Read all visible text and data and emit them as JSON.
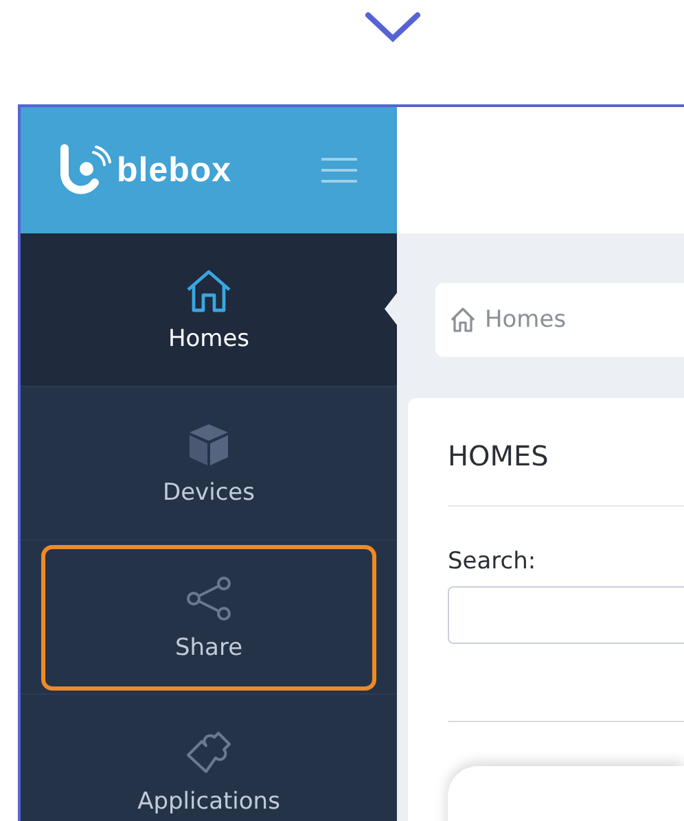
{
  "logo": {
    "text": "blebox"
  },
  "sidebar": {
    "items": [
      {
        "label": "Homes",
        "selected": true,
        "highlighted": false
      },
      {
        "label": "Devices",
        "selected": false,
        "highlighted": false
      },
      {
        "label": "Share",
        "selected": false,
        "highlighted": true
      },
      {
        "label": "Applications",
        "selected": false,
        "highlighted": false
      }
    ]
  },
  "breadcrumb": {
    "label": "Homes"
  },
  "panel": {
    "title": "HOMES",
    "search": {
      "label": "Search:"
    }
  }
}
